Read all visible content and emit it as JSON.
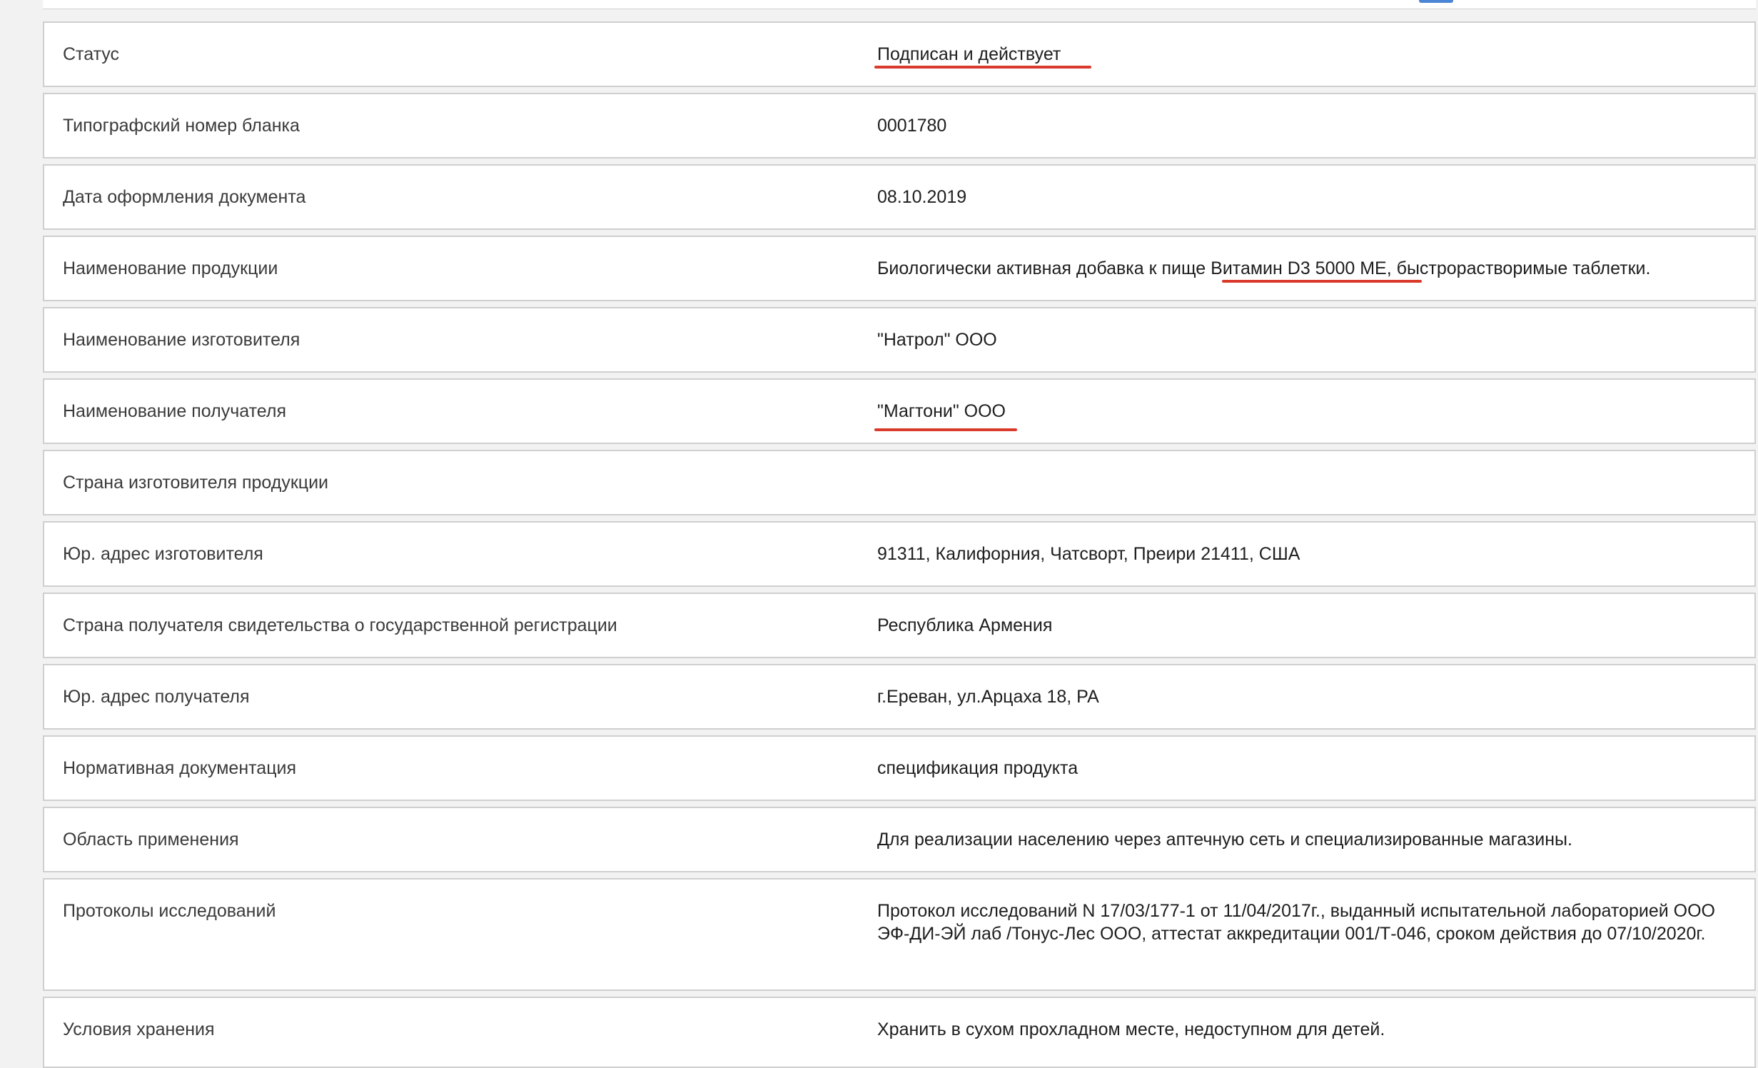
{
  "accent": "#d93a2b",
  "rows": [
    {
      "label": "Статус",
      "value": "Подписан и действует"
    },
    {
      "label": "Типографский номер бланка",
      "value": "0001780"
    },
    {
      "label": "Дата оформления документа",
      "value": "08.10.2019"
    },
    {
      "label": "Наименование продукции",
      "value": "Биологически активная добавка к пище Витамин D3 5000 МЕ, быстрорастворимые таблетки."
    },
    {
      "label": "Наименование изготовителя",
      "value": "\"Натрол\" ООО"
    },
    {
      "label": "Наименование получателя",
      "value": "\"Магтони\" ООО"
    },
    {
      "label": "Страна изготовителя продукции",
      "value": ""
    },
    {
      "label": "Юр. адрес изготовителя",
      "value": "91311, Калифорния, Чатсворт, Преири 21411, США"
    },
    {
      "label": "Страна получателя свидетельства о государственной регистрации",
      "value": "Республика Армения"
    },
    {
      "label": "Юр. адрес получателя",
      "value": "г.Ереван, ул.Арцаха 18, РА"
    },
    {
      "label": "Нормативная документация",
      "value": "спецификация продукта"
    },
    {
      "label": "Область применения",
      "value": "Для реализации населению через аптечную сеть и специализированные магазины."
    },
    {
      "label": "Протоколы исследований",
      "value": "Протокол исследований N 17/03/177-1 от 11/04/2017г., выданный испытательной лабораторией ООО ЭФ-ДИ-ЭЙ лаб /Тонус-Лес ООО, аттестат аккредитации 001/Т-046, сроком действия до 07/10/2020г."
    },
    {
      "label": "Условия хранения",
      "value": "Хранить в сухом прохладном месте, недоступном для детей."
    }
  ]
}
